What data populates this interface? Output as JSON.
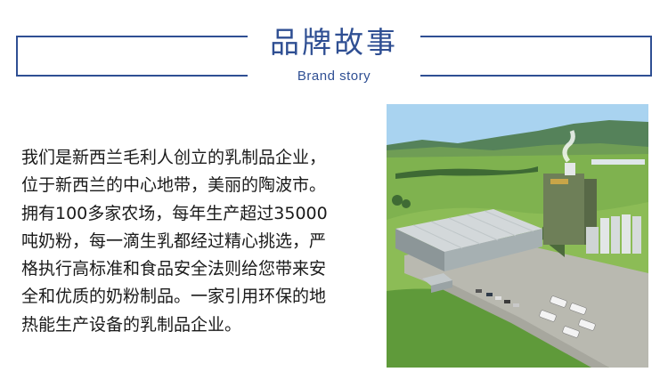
{
  "header": {
    "title": "品牌故事",
    "subtitle": "Brand story"
  },
  "story": {
    "lines": [
      "我们是新西兰毛利人创立的乳制品企业，",
      "位于新西兰的中心地带，美丽的陶波市。",
      "拥有100多家农场，每年生产超过35000",
      "吨奶粉，每一滴生乳都经过精心挑选，严",
      "格执行高标准和食品安全法则给您带来安",
      "全和优质的奶粉制品。一家引用环保的地",
      "热能生产设备的乳制品企业。"
    ]
  },
  "photo": {
    "subject": "aerial-view-of-dairy-factory",
    "colors": {
      "sky": "#a9d3f0",
      "hills_far": "#4d7a4a",
      "grass": "#7fb24f",
      "grass_dark": "#5f9a3a",
      "roof": "#c9cfd2",
      "tower": "#6e7f58",
      "lot": "#b9b9b0"
    }
  }
}
